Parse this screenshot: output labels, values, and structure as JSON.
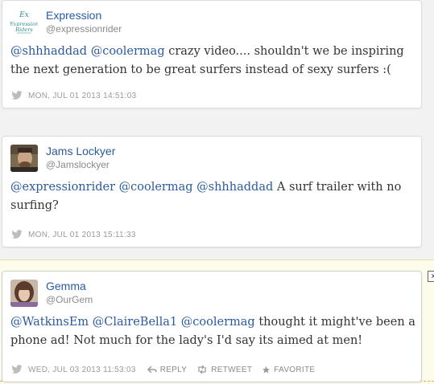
{
  "tweets": [
    {
      "name": "Expression",
      "handle": "@expressionrider",
      "text_parts": {
        "m1": "@shhhaddad",
        "m2": "@coolermag",
        "body": "crazy video.... shouldn't we be inspiring the next generation to be great surfers instead of sexy surfers :("
      },
      "timestamp": "MON, JUL 01 2013 14:51:03"
    },
    {
      "name": "Jams Lockyer",
      "handle": "@Jamslockyer",
      "text_parts": {
        "m1": "@expressionrider",
        "m2": "@coolermag",
        "m3": "@shhhaddad",
        "body": "A surf trailer with no surfing?"
      },
      "timestamp": "MON, JUL 01 2013 15:11:33"
    },
    {
      "name": "Gemma",
      "handle": "@OurGem",
      "text_parts": {
        "m1": "@WatkinsEm",
        "m2": "@ClaireBella1",
        "m3": "@coolermag",
        "body": "thought it might've been a phone ad! Not much for the lady's I'd say its aimed at men!"
      },
      "timestamp": "WED, JUL 03 2013 11:53:03",
      "actions": {
        "reply": "REPLY",
        "retweet": "RETWEET",
        "favorite": "FAVORITE"
      }
    }
  ],
  "close_label": "x",
  "colors": {
    "link": "#2a5aa0",
    "meta": "#9a9a9a",
    "highlight": "#fdfbe9"
  },
  "icons": [
    "twitter-bird-icon",
    "reply-icon",
    "retweet-icon",
    "favorite-star-icon",
    "close-icon"
  ]
}
